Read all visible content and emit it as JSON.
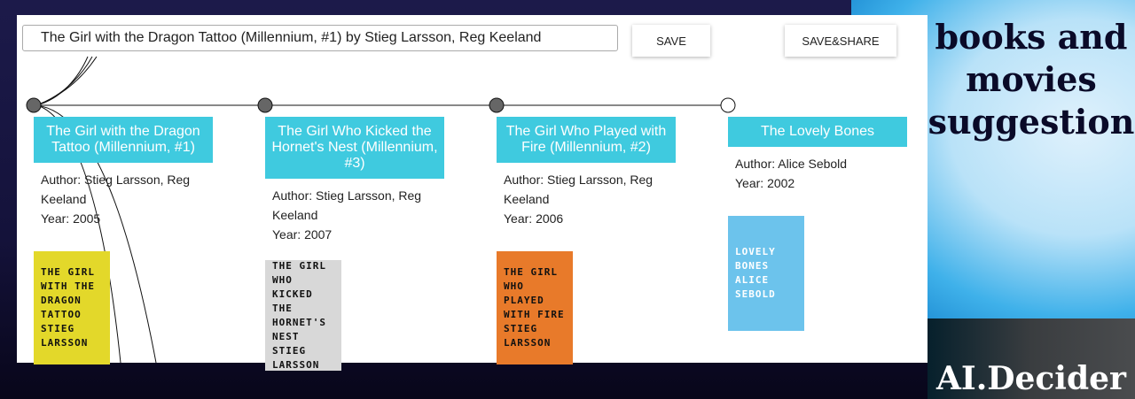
{
  "search": {
    "value": "The Girl with the Dragon Tattoo (Millennium, #1) by Stieg Larsson, Reg Keeland"
  },
  "toolbar": {
    "save_label": "SAVE",
    "save_share_label": "SAVE&SHARE"
  },
  "books": [
    {
      "title": "The Girl with the Dragon Tattoo (Millennium, #1)",
      "author": "Author: Stieg Larsson, Reg Keeland",
      "year": "Year: 2005",
      "cover_text": "THE GIRL WITH THE DRAGON TATTOO STIEG LARSSON",
      "cover_color": "#e3d82a",
      "node": "filled"
    },
    {
      "title": "The Girl Who Kicked the Hornet's Nest (Millennium, #3)",
      "author": "Author: Stieg Larsson, Reg Keeland",
      "year": "Year: 2007",
      "cover_text": "THE GIRL WHO KICKED THE HORNET'S NEST STIEG LARSSON",
      "cover_color": "#d8d8d8",
      "node": "filled"
    },
    {
      "title": "The Girl Who Played with Fire (Millennium, #2)",
      "author": "Author: Stieg Larsson, Reg Keeland",
      "year": "Year: 2006",
      "cover_text": "THE GIRL WHO PLAYED WITH FIRE STIEG LARSSON",
      "cover_color": "#e87a2a",
      "node": "filled"
    },
    {
      "title": "The Lovely Bones",
      "author": "Author: Alice Sebold",
      "year": "Year: 2002",
      "cover_text": "LOVELY BONES ALICE SEBOLD",
      "cover_color": "#6cc3ec",
      "node": "hollow"
    }
  ],
  "side": {
    "heading": "books and movies suggestion",
    "brand": "AI.Decider"
  }
}
